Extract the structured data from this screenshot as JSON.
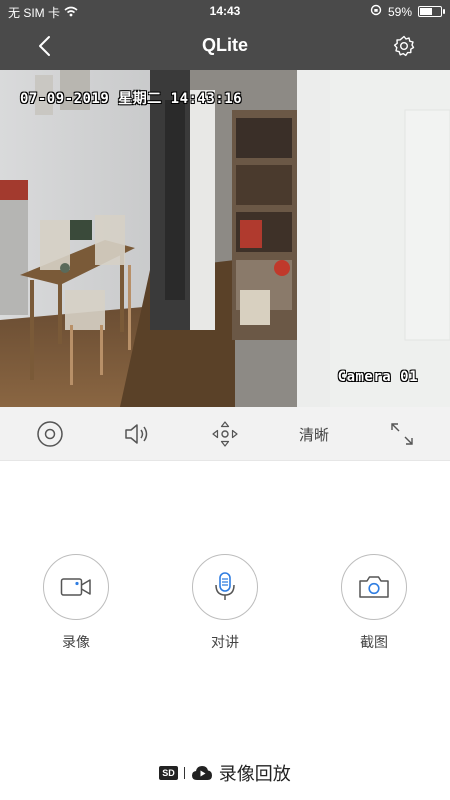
{
  "status_bar": {
    "carrier": "无 SIM 卡",
    "time": "14:43",
    "battery_percent": "59%",
    "battery_level": 0.59
  },
  "nav": {
    "title": "QLite",
    "back_icon": "chevron-left-icon",
    "settings_icon": "gear-icon"
  },
  "video": {
    "timestamp": "07-09-2019 星期二 14:43:16",
    "camera_label": "Camera 01"
  },
  "controls": {
    "record_stop_icon": "record-circle-icon",
    "volume_icon": "speaker-icon",
    "ptz_icon": "direction-pad-icon",
    "quality_label": "清晰",
    "fullscreen_icon": "expand-icon"
  },
  "actions": [
    {
      "icon": "video-camera-icon",
      "label": "录像"
    },
    {
      "icon": "microphone-icon",
      "label": "对讲"
    },
    {
      "icon": "camera-icon",
      "label": "截图"
    }
  ],
  "playback": {
    "badge": "SD",
    "label": "录像回放",
    "icon": "cloud-play-icon"
  },
  "colors": {
    "header_bg": "#4a4a4a",
    "control_bar_bg": "#f2f2f2",
    "accent_blue": "#2f7de1"
  }
}
